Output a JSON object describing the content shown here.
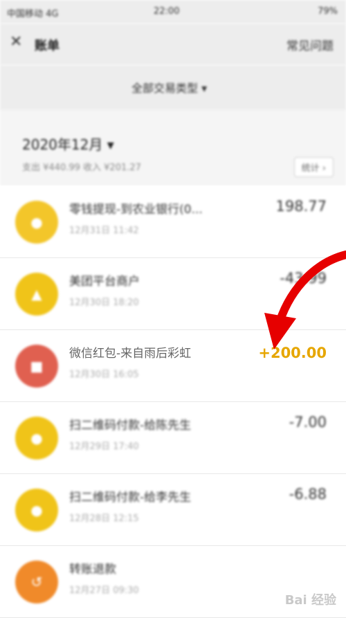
{
  "status_bar": {
    "carrier": "中国移动 4G",
    "time": "22:00",
    "battery": "79%"
  },
  "nav": {
    "title": "账单",
    "action": "常见问题"
  },
  "filter": {
    "label": "全部交易类型"
  },
  "month_header": {
    "month": "2020年12月",
    "summary": "支出 ¥440.99  收入 ¥201.27",
    "stats_button": "统计"
  },
  "transactions": [
    {
      "name": "零钱提现-到农业银行(0...",
      "time": "12月31日 11:42",
      "amount": "198.77",
      "icon": "coin-icon",
      "icon_color": "#f3c62a",
      "highlight": false
    },
    {
      "name": "美团平台商户",
      "time": "12月30日 18:20",
      "amount": "-43.99",
      "icon": "kangaroo-icon",
      "icon_color": "#f0c419",
      "highlight": false
    },
    {
      "name": "微信红包-来自雨后彩虹",
      "time": "12月30日 16:05",
      "amount": "+200.00",
      "icon": "red-packet-icon",
      "icon_color": "#e06050",
      "highlight": true
    },
    {
      "name": "扫二维码付款-给陈先生",
      "time": "12月29日 17:40",
      "amount": "-7.00",
      "icon": "money-bag-icon",
      "icon_color": "#f0c419",
      "highlight": false
    },
    {
      "name": "扫二维码付款-给李先生",
      "time": "12月28日 12:15",
      "amount": "-6.88",
      "icon": "money-bag-icon",
      "icon_color": "#f0c419",
      "highlight": false
    },
    {
      "name": "转账退款",
      "time": "12月27日 09:30",
      "amount": "",
      "icon": "refund-icon",
      "icon_color": "#f08a2a",
      "highlight": false
    }
  ],
  "watermark": "Bai 经验",
  "colors": {
    "income": "#e6a600",
    "arrow": "#e60000"
  }
}
